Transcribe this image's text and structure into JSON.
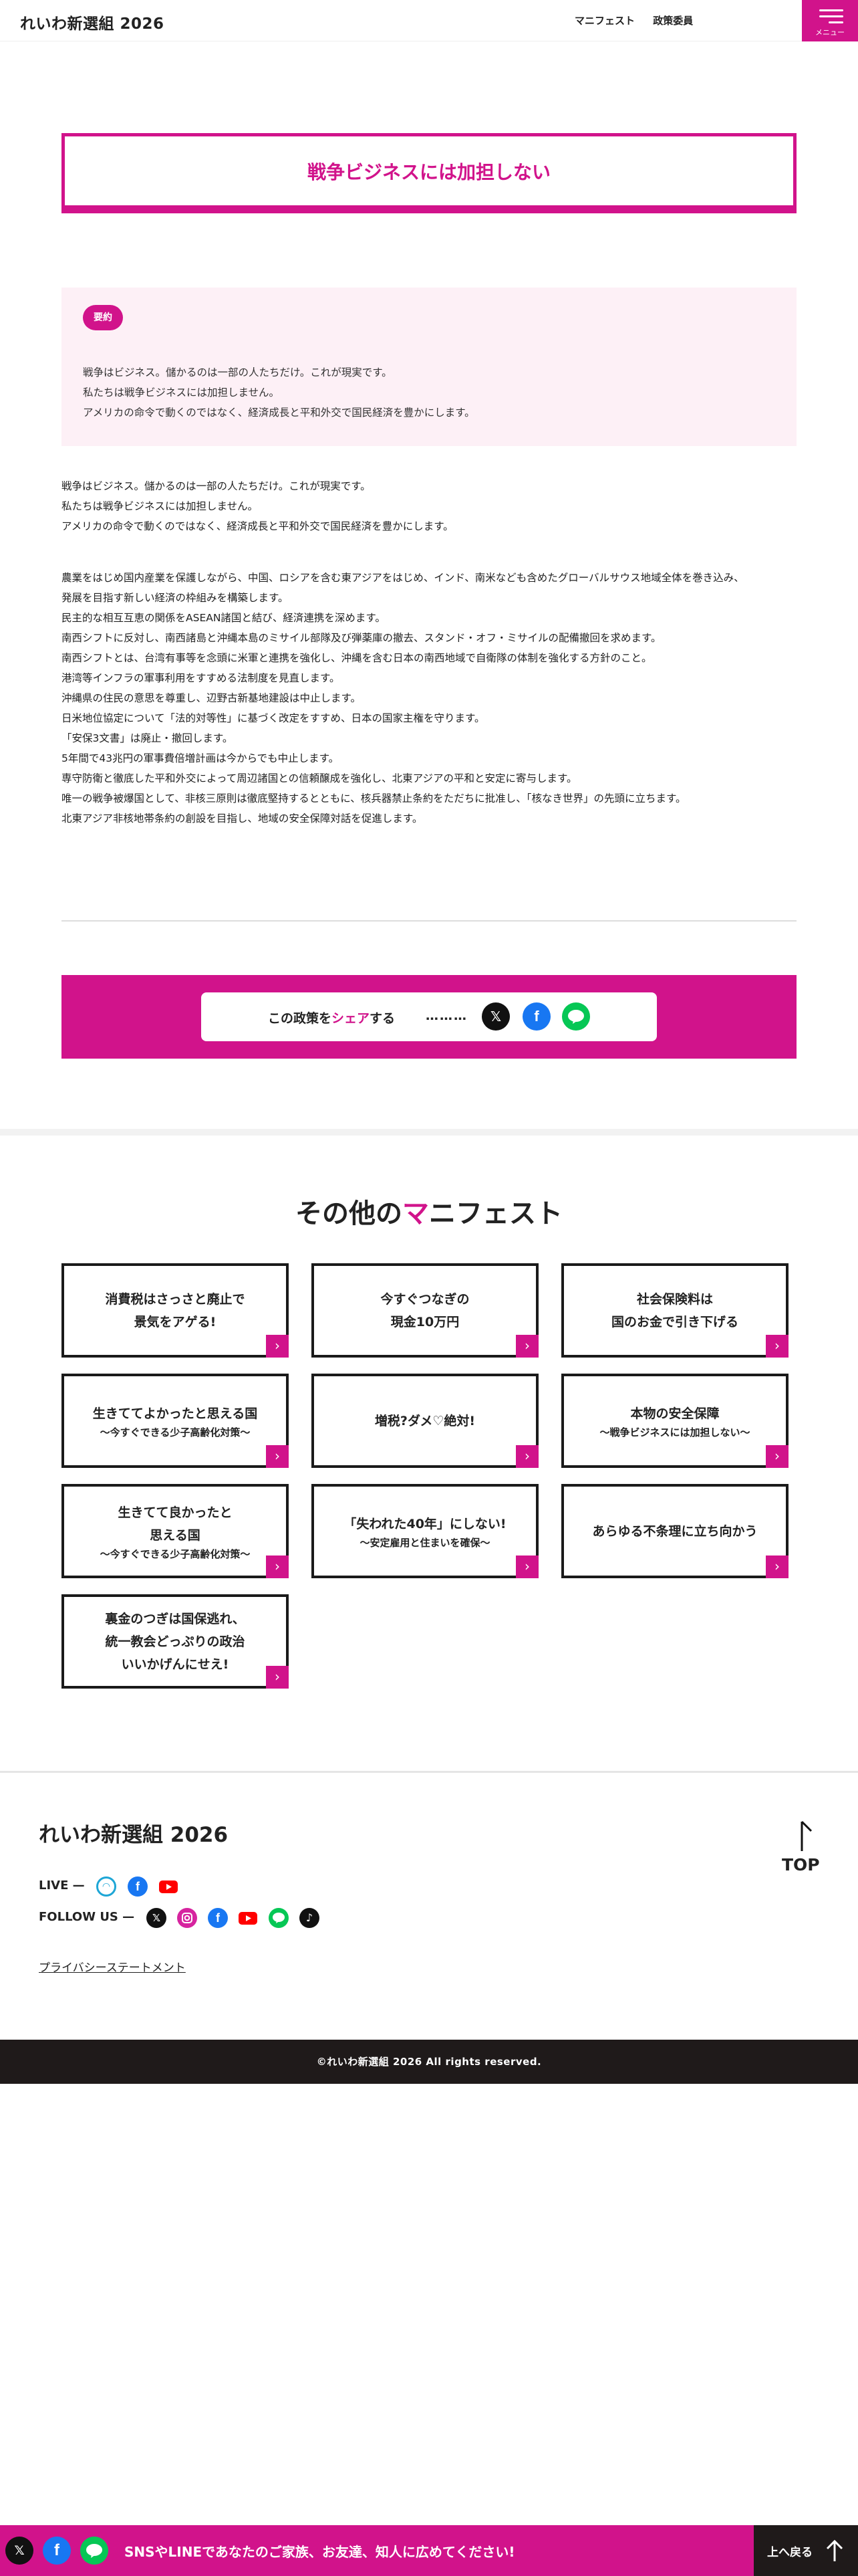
{
  "header": {
    "logo": "れいわ新選組 2026",
    "nav": [
      "マニフェスト",
      "政策委員"
    ],
    "menu_label": "メニュー"
  },
  "policy": {
    "title": "戦争ビジネスには加担しない",
    "summary_badge": "要約",
    "summary_lines": [
      "戦争はビジネス。儲かるのは一部の人たちだけ。これが現実です。",
      "私たちは戦争ビジネスには加担しません。",
      "アメリカの命令で動くのではなく、経済成長と平和外交で国民経済を豊かにします。"
    ],
    "intro_lines": [
      "戦争はビジネス。儲かるのは一部の人たちだけ。これが現実です。",
      "私たちは戦争ビジネスには加担しません。",
      "アメリカの命令で動くのではなく、経済成長と平和外交で国民経済を豊かにします。"
    ],
    "body_lines": [
      "農業をはじめ国内産業を保護しながら、中国、ロシアを含む東アジアをはじめ、インド、南米なども含めたグローバルサウス地域全体を巻き込み、",
      "発展を目指す新しい経済の枠組みを構築します。",
      "民主的な相互互恵の関係をASEAN諸国と結び、経済連携を深めます。",
      "南西シフトに反対し、南西諸島と沖縄本島のミサイル部隊及び弾薬庫の撤去、スタンド・オフ・ミサイルの配備撤回を求めます。",
      "南西シフトとは、台湾有事等を念頭に米軍と連携を強化し、沖縄を含む日本の南西地域で自衛隊の体制を強化する方針のこと。",
      "港湾等インフラの軍事利用をすすめる法制度を見直します。",
      "沖縄県の住民の意思を尊重し、辺野古新基地建設は中止します。",
      "日米地位協定について「法的対等性」に基づく改定をすすめ、日本の国家主権を守ります。",
      "「安保3文書」は廃止・撤回します。",
      "5年間で43兆円の軍事費倍増計画は今からでも中止します。",
      "専守防衛と徹底した平和外交によって周辺諸国との信頼醸成を強化し、北東アジアの平和と安定に寄与します。",
      "唯一の戦争被爆国として、非核三原則は徹底堅持するとともに、核兵器禁止条約をただちに批准し、「核なき世界」の先頭に立ちます。",
      "北東アジア非核地帯条約の創設を目指し、地域の安全保障対話を促進します。"
    ]
  },
  "share": {
    "prefix": "この政策を",
    "highlight": "シェア",
    "suffix": "する",
    "dots": "………",
    "icons": [
      "x-icon",
      "facebook-icon",
      "line-icon"
    ]
  },
  "other": {
    "title_pre": "その他の",
    "title_highlight": "マ",
    "title_post": "ニフェスト",
    "cards": [
      {
        "title": [
          "消費税はさっさと廃止で",
          "景気をアゲる!"
        ],
        "sub": ""
      },
      {
        "title": [
          "今すぐつなぎの",
          "現金10万円"
        ],
        "sub": ""
      },
      {
        "title": [
          "社会保険料は",
          "国のお金で引き下げる"
        ],
        "sub": ""
      },
      {
        "title": [
          "生きててよかったと思える国"
        ],
        "sub": "〜今すぐできる少子高齢化対策〜"
      },
      {
        "title": [
          "増税?ダメ♡絶対!"
        ],
        "sub": ""
      },
      {
        "title": [
          "本物の安全保障"
        ],
        "sub": "〜戦争ビジネスには加担しない〜"
      },
      {
        "title": [
          "生きてて良かったと",
          "思える国"
        ],
        "sub": "〜今すぐできる少子高齢化対策〜"
      },
      {
        "title": [
          "「失われた40年」にしない!"
        ],
        "sub": "〜安定雇用と住まいを確保〜"
      },
      {
        "title": [
          "あらゆる不条理に立ち向かう"
        ],
        "sub": ""
      },
      {
        "title": [
          "裏金のつぎは国保逃れ、",
          "統一教会どっぷりの政治",
          "いいかげんにせえ!"
        ],
        "sub": ""
      }
    ]
  },
  "footer": {
    "logo": "れいわ新選組 2026",
    "live_label": "LIVE —",
    "follow_label": "FOLLOW US —",
    "privacy": "プライバシーステートメント",
    "top_label": "TOP",
    "copyright": "©れいわ新選組 2026 All rights reserved."
  },
  "bottom_bar": {
    "text": "SNSやLINEであなたのご家族、お友達、知人に広めてください!",
    "back_to_top": "上へ戻る"
  },
  "colors": {
    "accent": "#d1138b",
    "dark": "#1f1a1a",
    "summary_bg": "#fdf0f6"
  }
}
